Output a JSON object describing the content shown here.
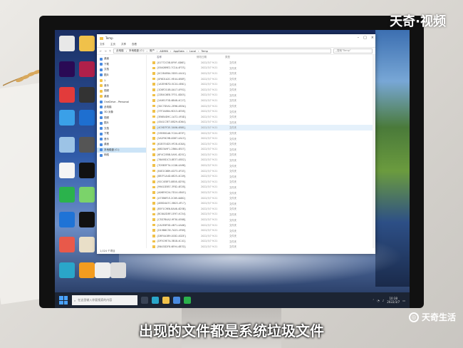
{
  "explorer": {
    "title": "Temp",
    "ribbon_tabs": [
      "文件",
      "主页",
      "共享",
      "查看"
    ],
    "breadcrumb": [
      "此电脑",
      "本地磁盘 (C:)",
      "用户",
      "ADMIN",
      "AppData",
      "Local",
      "Temp"
    ],
    "search_placeholder": "搜索\"Temp\"",
    "columns": [
      "名称",
      "修改日期",
      "类型"
    ],
    "nav_items": [
      {
        "label": "桌面",
        "kind": "sys"
      },
      {
        "label": "下载",
        "kind": "sys"
      },
      {
        "label": "文档",
        "kind": "sys"
      },
      {
        "label": "图片",
        "kind": "sys"
      },
      {
        "label": "1",
        "kind": "folder"
      },
      {
        "label": "音乐",
        "kind": "folder"
      },
      {
        "label": "视频",
        "kind": "folder"
      },
      {
        "label": "桌面",
        "kind": "folder"
      },
      {
        "label": "OneDrive - Personal",
        "kind": "sys"
      },
      {
        "label": "此电脑",
        "kind": "sys"
      },
      {
        "label": "3D 对象",
        "kind": "sys"
      },
      {
        "label": "视频",
        "kind": "sys"
      },
      {
        "label": "图片",
        "kind": "sys"
      },
      {
        "label": "文档",
        "kind": "sys"
      },
      {
        "label": "下载",
        "kind": "sys"
      },
      {
        "label": "音乐",
        "kind": "sys"
      },
      {
        "label": "桌面",
        "kind": "sys"
      },
      {
        "label": "本地磁盘 (C:)",
        "kind": "sys",
        "selected": true
      },
      {
        "label": "网络",
        "kind": "sys"
      }
    ],
    "files": [
      {
        "name": "{01772C5B-8F9F-4D6E}",
        "date": "2022/3/7 9:21",
        "type": "文件夹"
      },
      {
        "name": "{05A0B9E2-7C1A-4F33}",
        "date": "2022/3/7 9:21",
        "type": "文件夹"
      },
      {
        "name": "{0C2B4E8A-3D55-4A10}",
        "date": "2022/3/7 9:21",
        "type": "文件夹"
      },
      {
        "name": "{0F6D1A2C-9E44-4B8F}",
        "date": "2022/3/7 9:21",
        "type": "文件夹"
      },
      {
        "name": "{1A3E9B7D-5C20-4E61}",
        "date": "2022/3/7 9:21",
        "type": "文件夹"
      },
      {
        "name": "{1D8F2C4B-0A17-4F92}",
        "date": "2022/3/7 9:21",
        "type": "文件夹"
      },
      {
        "name": "{22B4C6E8-7F31-4D05}",
        "date": "2022/3/7 9:21",
        "type": "文件夹"
      },
      {
        "name": "{2A9E1F3D-6B48-4C27}",
        "date": "2022/3/7 9:21",
        "type": "文件夹"
      },
      {
        "name": "{30C7D5A1-2E96-4B3A}",
        "date": "2022/3/7 9:21",
        "type": "文件夹"
      },
      {
        "name": "{37F2A8B4-9D13-4E58}",
        "date": "2022/3/7 9:21",
        "type": "文件夹"
      },
      {
        "name": "{3E6B4D9C-1A72-4F0D}",
        "date": "2022/3/7 9:21",
        "type": "文件夹"
      },
      {
        "name": "{45A1C3E7-8B29-4D64}",
        "date": "2022/3/7 9:21",
        "type": "文件夹"
      },
      {
        "name": "{4C9D7F2E-3A56-4B81}",
        "date": "2022/3/7 9:21",
        "type": "文件夹"
      },
      {
        "name": "{53E8B1A6-7C04-4E3F}",
        "date": "2022/3/7 9:21",
        "type": "文件夹"
      },
      {
        "name": "{5A2F6C9B-0D87-4A15}",
        "date": "2022/3/7 9:21",
        "type": "文件夹"
      },
      {
        "name": "{61B7E4D3-9F28-4C6A}",
        "date": "2022/3/7 9:21",
        "type": "文件夹"
      },
      {
        "name": "{68D3A9F1-2B64-4E07}",
        "date": "2022/3/7 9:21",
        "type": "文件夹"
      },
      {
        "name": "{6F4C2E8B-5A91-4D3C}",
        "date": "2022/3/7 9:21",
        "type": "文件夹"
      },
      {
        "name": "{76A9D1C5-8E37-4B52}",
        "date": "2022/3/7 9:21",
        "type": "文件夹"
      },
      {
        "name": "{7D5B3F7A-1C06-4A98}",
        "date": "2022/3/7 9:21",
        "type": "文件夹"
      },
      {
        "name": "{84E2C6B9-4D73-4F1E}",
        "date": "2022/3/7 9:21",
        "type": "文件夹"
      },
      {
        "name": "{8B7F1A4D-6E25-4C09}",
        "date": "2022/3/7 9:21",
        "type": "文件夹"
      },
      {
        "name": "{92C4E8F3-0B58-4D76}",
        "date": "2022/3/7 9:21",
        "type": "文件夹"
      },
      {
        "name": "{99A1D5B7-3F82-4E2B}",
        "date": "2022/3/7 9:21",
        "type": "文件夹"
      },
      {
        "name": "{A06E9C2A-7D14-4B45}",
        "date": "2022/3/7 9:21",
        "type": "文件夹"
      },
      {
        "name": "{A73B6F1E-2C69-4A80}",
        "date": "2022/3/7 9:21",
        "type": "文件夹"
      },
      {
        "name": "{AE8D4A7C-5B03-4F17}",
        "date": "2022/3/7 9:21",
        "type": "文件夹"
      },
      {
        "name": "{B5F1C9E6-8A46-4D3B}",
        "date": "2022/3/7 9:21",
        "type": "文件夹"
      },
      {
        "name": "{BC6A2D8F-1E97-4C54}",
        "date": "2022/3/7 9:21",
        "type": "文件夹"
      },
      {
        "name": "{C3D7B4A2-9F30-4E68}",
        "date": "2022/3/7 9:21",
        "type": "文件夹"
      },
      {
        "name": "{CA2E8F5D-4B71-4A06}",
        "date": "2022/3/7 9:21",
        "type": "文件夹"
      },
      {
        "name": "{D19B6C3E-7A25-4F89}",
        "date": "2022/3/7 9:21",
        "type": "文件夹"
      },
      {
        "name": "{D8F4A1B9-0C62-4D2E}",
        "date": "2022/3/7 9:21",
        "type": "文件夹"
      },
      {
        "name": "{DF5C9E7A-3B18-4C41}",
        "date": "2022/3/7 9:21",
        "type": "文件夹"
      },
      {
        "name": "{E6A3D2F8-6E94-4B7D}",
        "date": "2022/3/7 9:21",
        "type": "文件夹"
      }
    ],
    "status": "1,024 个项目"
  },
  "taskbar": {
    "search_placeholder": "在这里输入你要搜索的内容",
    "time": "10:38",
    "date": "2022/3/7"
  },
  "overlay": {
    "watermark": "天奇·视频",
    "logo_text": "天奇生活",
    "subtitle": "出现的文件都是系统垃圾文件"
  },
  "colors": {
    "folder": "#f0c14a",
    "selection": "#cce4f7",
    "taskbar": "#1c2433"
  }
}
